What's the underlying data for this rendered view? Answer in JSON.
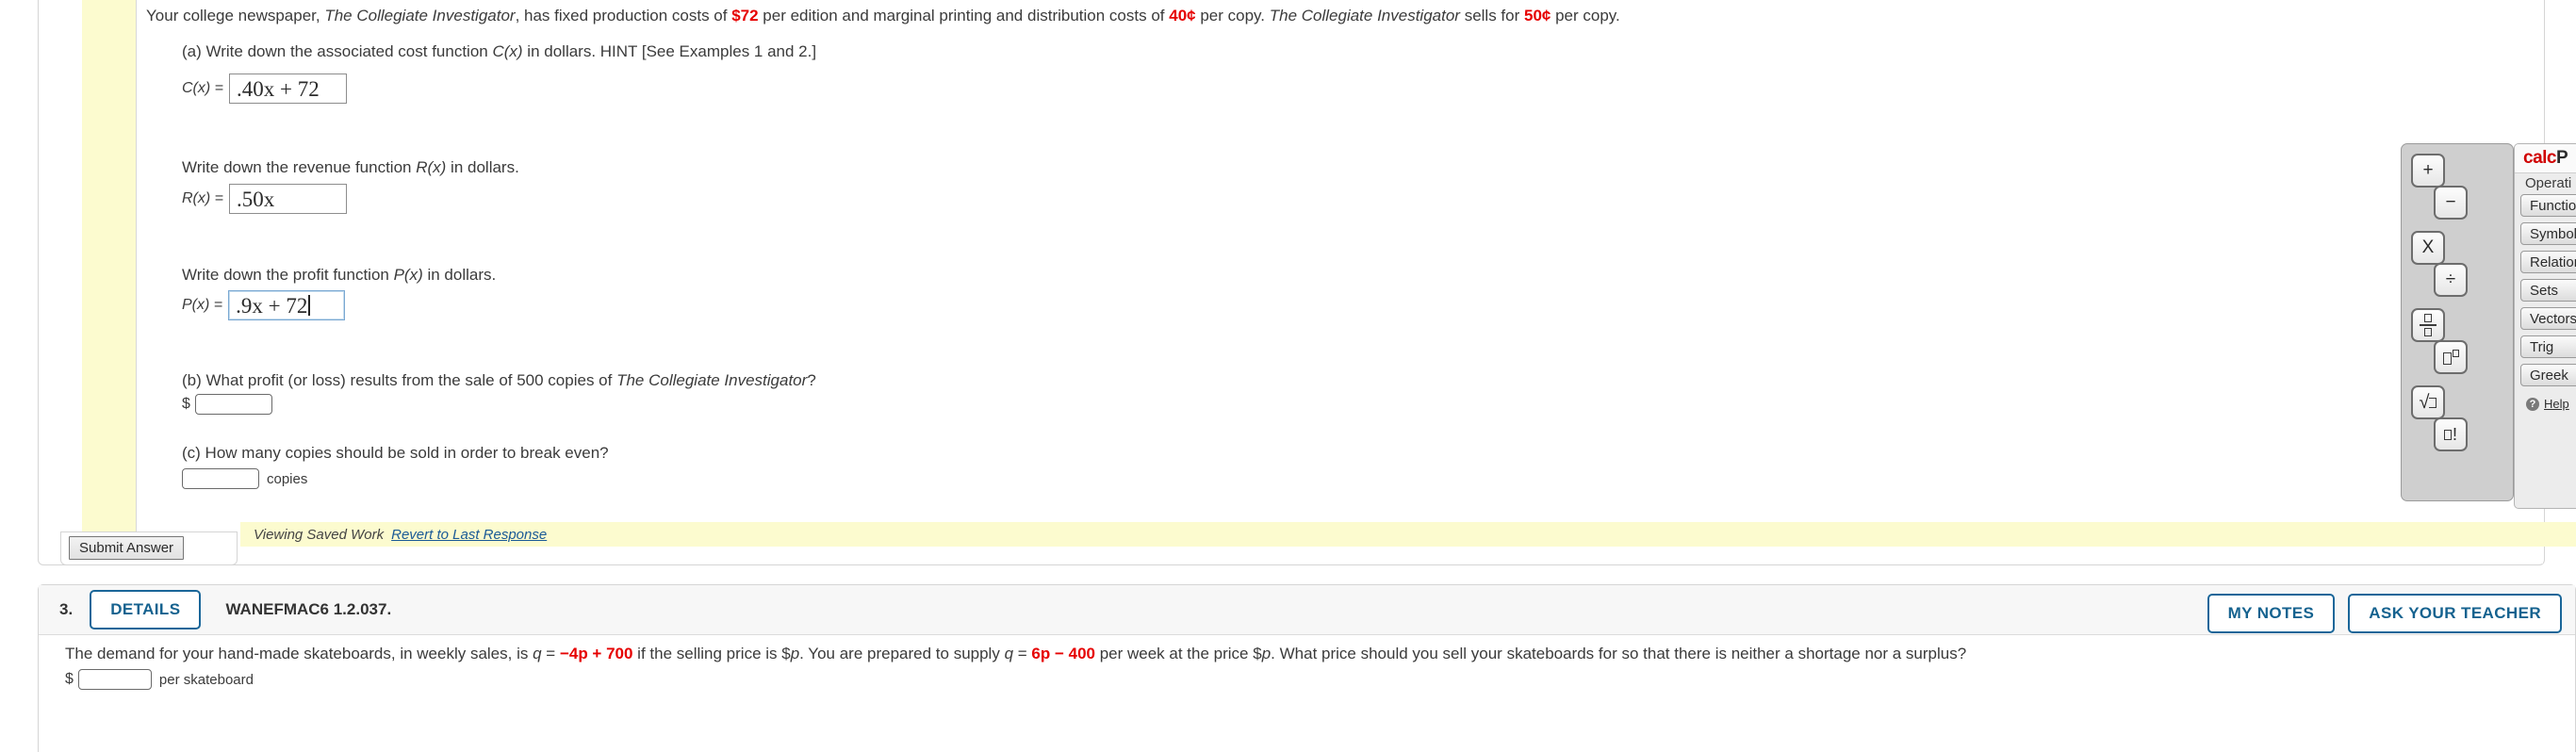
{
  "question2": {
    "prompt": {
      "seg1": "Your college newspaper, ",
      "title1": "The Collegiate Investigator",
      "seg2": ", has fixed production costs of ",
      "val1": "$72",
      "seg3": " per edition and marginal printing and distribution costs of ",
      "val2": "40¢",
      "seg4": " per copy. ",
      "title2": "The Collegiate Investigator",
      "seg5": " sells for ",
      "val3": "50¢",
      "seg6": " per copy."
    },
    "part_a": {
      "instruction_pre": "(a) Write down the associated cost function ",
      "instruction_var": "C(x)",
      "instruction_post": " in dollars. HINT [See Examples 1 and 2.]",
      "field_label": "C(x) =",
      "field_value": ".40x + 72"
    },
    "revenue": {
      "instruction_pre": "Write down the revenue function ",
      "instruction_var": "R(x)",
      "instruction_post": " in dollars.",
      "field_label": "R(x) =",
      "field_value": ".50x"
    },
    "profit": {
      "instruction_pre": "Write down the profit function ",
      "instruction_var": "P(x)",
      "instruction_post": " in dollars.",
      "field_label": "P(x) =",
      "field_value": ".9x + 72"
    },
    "part_b": {
      "q_pre": "(b) What profit (or loss) results from the sale of 500 copies of ",
      "q_title": "The Collegiate Investigator",
      "q_post": "?",
      "dollar_sign": "$",
      "field_value": "",
      "field_placeholder": ""
    },
    "part_c": {
      "question": "(c) How many copies should be sold in order to break even?",
      "field_value": "",
      "field_placeholder": "",
      "unit": "copies"
    },
    "submit_label": "Submit Answer",
    "saved_work_label": "Viewing Saved Work",
    "revert_link": "Revert to Last Response"
  },
  "calcpad": {
    "keys": [
      {
        "name": "plus-key",
        "glyph": "+"
      },
      {
        "name": "minus-key",
        "glyph": "−"
      },
      {
        "name": "multiply-key",
        "glyph": "X"
      },
      {
        "name": "divide-key",
        "glyph": "÷"
      },
      {
        "name": "fraction-key",
        "glyph": "fraction"
      },
      {
        "name": "exponent-key",
        "glyph": "exponent"
      },
      {
        "name": "square-root-key",
        "glyph": "sqrt"
      },
      {
        "name": "factorial-key",
        "glyph": "factorial"
      }
    ],
    "brand_calc": "calc",
    "brand_pad": "P",
    "subtitle": "Operati",
    "categories": [
      "Functio",
      "Symbol",
      "Relation",
      "Sets",
      "Vectors",
      "Trig",
      "Greek"
    ],
    "help_label": "Help"
  },
  "question3": {
    "number": "3.",
    "details_label": "DETAILS",
    "code": "WANEFMAC6 1.2.037.",
    "my_notes_label": "MY NOTES",
    "ask_teacher_label": "ASK YOUR TEACHER",
    "prompt": {
      "seg1": "The demand for your hand-made skateboards, in weekly sales, is ",
      "eq1_var": "q",
      "eq1_eq": " = ",
      "eq1_val": "−4p + 700",
      "seg2": " if the selling price is $",
      "var_p1": "p",
      "seg3": ". You are prepared to supply ",
      "eq2_var": "q",
      "eq2_eq": " = ",
      "eq2_val": "6p − 400",
      "seg4": " per week at the price $",
      "var_p2": "p",
      "seg5": ". What price should you sell your skateboards for so that there is neither a shortage nor a surplus?"
    },
    "dollar_sign": "$",
    "field_value": "",
    "field_placeholder": "",
    "unit": "per skateboard"
  },
  "colors": {
    "accent_blue": "#15628f",
    "highlight_red": "#e60000",
    "yellow_strip": "#fcfbcf",
    "calcpad_red": "#d00000"
  }
}
